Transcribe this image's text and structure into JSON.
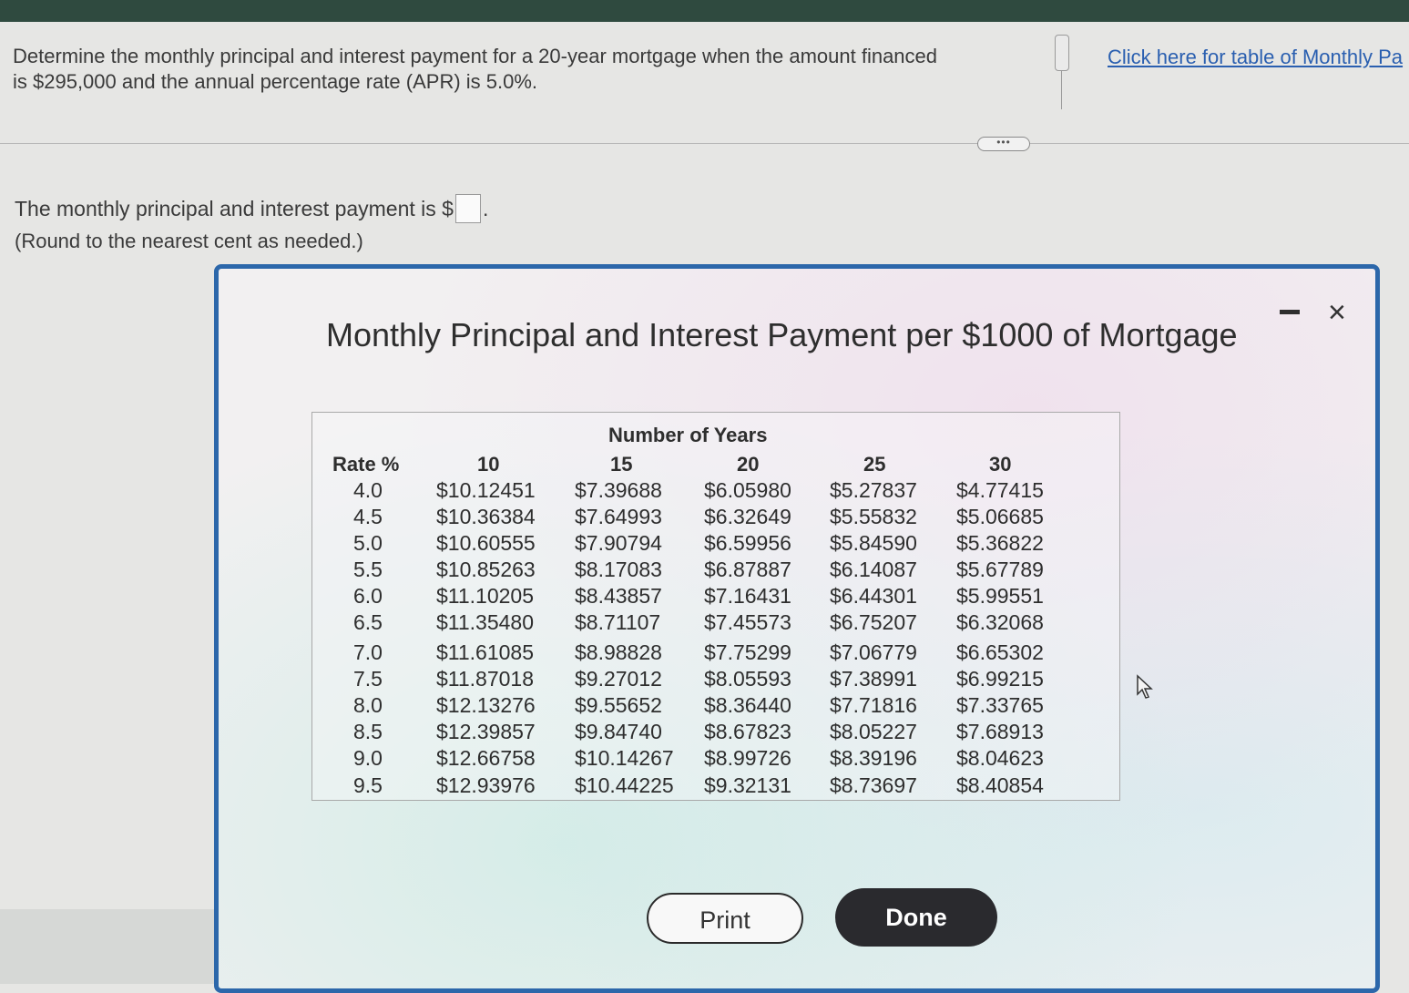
{
  "question": {
    "line1": "Determine the monthly principal and interest payment for a 20-year mortgage when the amount financed",
    "line2": "is $295,000 and the annual percentage rate (APR) is 5.0%.",
    "table_link": "Click here for table of Monthly Pa"
  },
  "answer": {
    "prefix": "The monthly principal and interest payment is $",
    "suffix": ".",
    "value": "",
    "note": "(Round to the nearest cent as needed.)"
  },
  "more_button": "•••",
  "modal": {
    "title": "Monthly Principal and Interest Payment per $1000 of Mortgage",
    "table": {
      "years_heading": "Number of Years",
      "rate_header": "Rate %",
      "year_headers": [
        "10",
        "15",
        "20",
        "25",
        "30"
      ],
      "rows": [
        {
          "rate": "4.0",
          "y10": "$10.12451",
          "y15": "$7.39688",
          "y20": "$6.05980",
          "y25": "$5.27837",
          "y30": "$4.77415"
        },
        {
          "rate": "4.5",
          "y10": "$10.36384",
          "y15": "$7.64993",
          "y20": "$6.32649",
          "y25": "$5.55832",
          "y30": "$5.06685"
        },
        {
          "rate": "5.0",
          "y10": "$10.60555",
          "y15": "$7.90794",
          "y20": "$6.59956",
          "y25": "$5.84590",
          "y30": "$5.36822"
        },
        {
          "rate": "5.5",
          "y10": "$10.85263",
          "y15": "$8.17083",
          "y20": "$6.87887",
          "y25": "$6.14087",
          "y30": "$5.67789"
        },
        {
          "rate": "6.0",
          "y10": "$11.10205",
          "y15": "$8.43857",
          "y20": "$7.16431",
          "y25": "$6.44301",
          "y30": "$5.99551"
        },
        {
          "rate": "6.5",
          "y10": "$11.35480",
          "y15": "$8.71107",
          "y20": "$7.45573",
          "y25": "$6.75207",
          "y30": "$6.32068"
        },
        {
          "rate": "7.0",
          "y10": "$11.61085",
          "y15": "$8.98828",
          "y20": "$7.75299",
          "y25": "$7.06779",
          "y30": "$6.65302"
        },
        {
          "rate": "7.5",
          "y10": "$11.87018",
          "y15": "$9.27012",
          "y20": "$8.05593",
          "y25": "$7.38991",
          "y30": "$6.99215"
        },
        {
          "rate": "8.0",
          "y10": "$12.13276",
          "y15": "$9.55652",
          "y20": "$8.36440",
          "y25": "$7.71816",
          "y30": "$7.33765"
        },
        {
          "rate": "8.5",
          "y10": "$12.39857",
          "y15": "$9.84740",
          "y20": "$8.67823",
          "y25": "$8.05227",
          "y30": "$7.68913"
        },
        {
          "rate": "9.0",
          "y10": "$12.66758",
          "y15": "$10.14267",
          "y20": "$8.99726",
          "y25": "$8.39196",
          "y30": "$8.04623"
        },
        {
          "rate": "9.5",
          "y10": "$12.93976",
          "y15": "$10.44225",
          "y20": "$9.32131",
          "y25": "$8.73697",
          "y30": "$8.40854"
        }
      ]
    },
    "print_label": "Print",
    "done_label": "Done",
    "close_symbol": "×"
  }
}
